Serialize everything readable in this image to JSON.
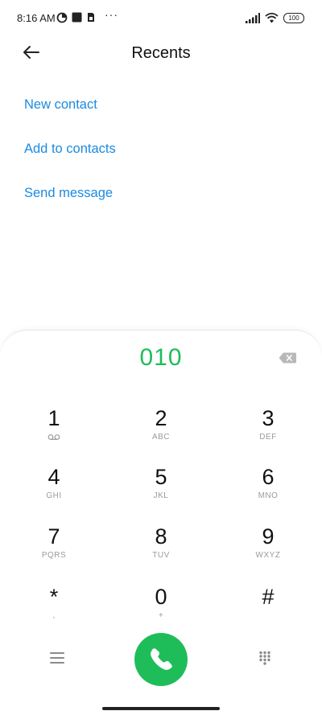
{
  "status_bar": {
    "time": "8:16 AM",
    "battery": "100",
    "more": "···",
    "icons": [
      "data-saver-icon",
      "square-notification-icon",
      "sim-icon",
      "signal-icon",
      "wifi-icon",
      "battery-icon"
    ]
  },
  "header": {
    "title": "Recents",
    "back_icon": "back-arrow-icon"
  },
  "actions": {
    "new_contact": "New contact",
    "add_to_contacts": "Add to contacts",
    "send_message": "Send message"
  },
  "dialer": {
    "number": "010",
    "accent_color": "#1fbd5a",
    "keys": [
      {
        "digit": "1",
        "letters": ""
      },
      {
        "digit": "2",
        "letters": "ABC"
      },
      {
        "digit": "3",
        "letters": "DEF"
      },
      {
        "digit": "4",
        "letters": "GHI"
      },
      {
        "digit": "5",
        "letters": "JKL"
      },
      {
        "digit": "6",
        "letters": "MNO"
      },
      {
        "digit": "7",
        "letters": "PQRS"
      },
      {
        "digit": "8",
        "letters": "TUV"
      },
      {
        "digit": "9",
        "letters": "WXYZ"
      },
      {
        "digit": "*",
        "letters": ","
      },
      {
        "digit": "0",
        "letters": "+"
      },
      {
        "digit": "#",
        "letters": ""
      }
    ],
    "bottom_icons": [
      "menu-icon",
      "phone-call-icon",
      "dialpad-icon"
    ]
  },
  "colors": {
    "link": "#1a8ae0",
    "call": "#1fbd5a"
  }
}
